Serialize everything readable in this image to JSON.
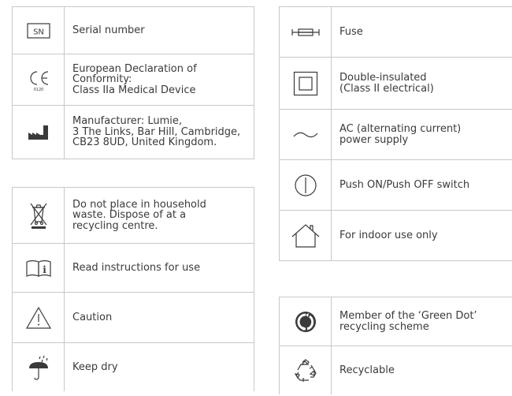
{
  "left_table_1": [
    {
      "icon": "serial-number-icon",
      "icon_text": "SN",
      "lines": [
        "Serial number"
      ]
    },
    {
      "icon": "ce-mark-icon",
      "icon_text": "0120",
      "lines": [
        "European Declaration of",
        "Conformity:",
        "Class IIa Medical Device"
      ]
    },
    {
      "icon": "manufacturer-icon",
      "lines": [
        "Manufacturer: Lumie,",
        "3 The Links, Bar Hill, Cambridge,",
        "CB23 8UD, United Kingdom."
      ]
    }
  ],
  "left_table_2": [
    {
      "icon": "weee-bin-icon",
      "lines": [
        "Do not place in household",
        "waste. Dispose of at a",
        "recycling centre."
      ]
    },
    {
      "icon": "read-instructions-icon",
      "lines": [
        "Read instructions for use"
      ]
    },
    {
      "icon": "caution-icon",
      "lines": [
        "Caution"
      ]
    },
    {
      "icon": "keep-dry-icon",
      "lines": [
        "Keep dry"
      ]
    }
  ],
  "right_table_1": [
    {
      "icon": "fuse-icon",
      "lines": [
        "Fuse"
      ]
    },
    {
      "icon": "double-insulated-icon",
      "lines": [
        "Double-insulated",
        "(Class II electrical)"
      ]
    },
    {
      "icon": "ac-supply-icon",
      "lines": [
        "AC (alternating current)",
        "power supply"
      ]
    },
    {
      "icon": "push-switch-icon",
      "lines": [
        "Push ON/Push OFF switch"
      ]
    },
    {
      "icon": "indoor-use-icon",
      "lines": [
        "For indoor use only"
      ]
    }
  ],
  "right_table_2": [
    {
      "icon": "green-dot-icon",
      "lines": [
        "Member of the ‘Green Dot’",
        "recycling scheme"
      ]
    },
    {
      "icon": "recyclable-icon",
      "lines": [
        "Recyclable"
      ]
    }
  ]
}
